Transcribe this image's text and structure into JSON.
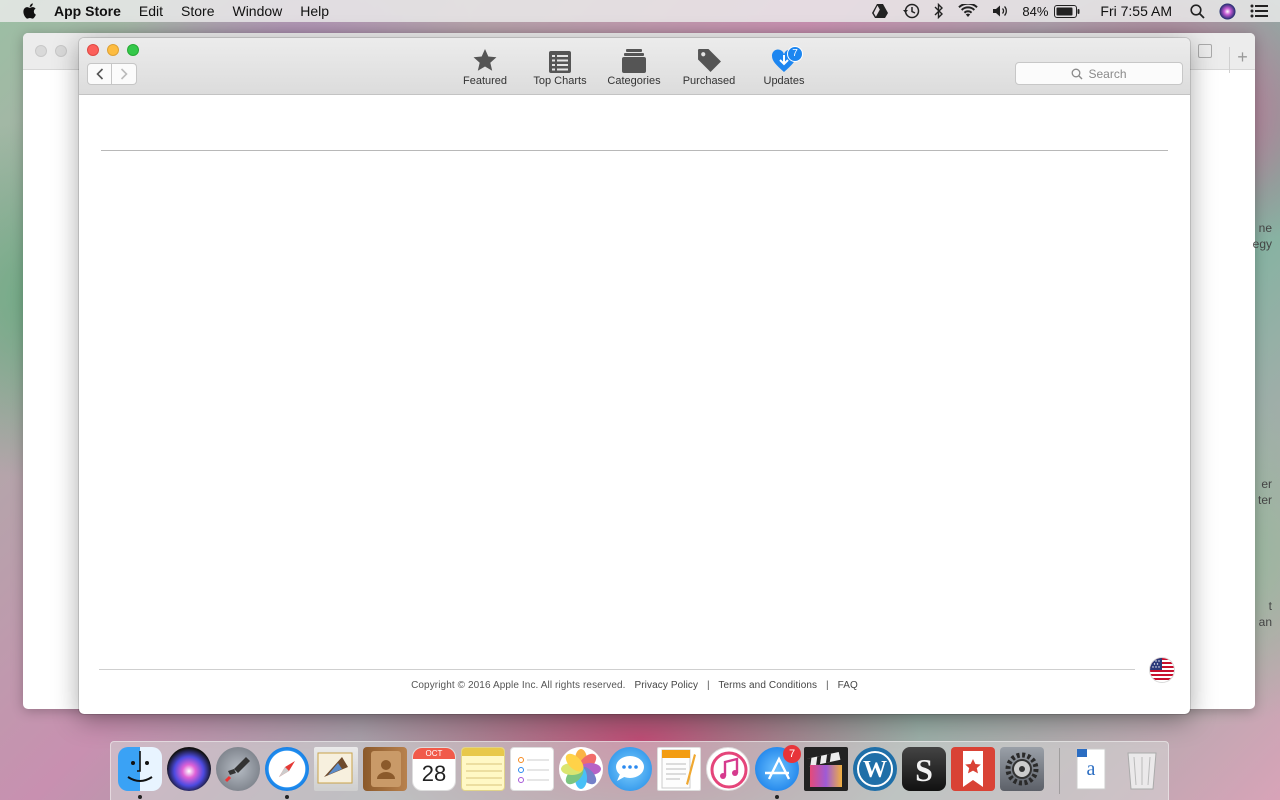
{
  "menubar": {
    "app_name": "App Store",
    "menus": [
      "Edit",
      "Store",
      "Window",
      "Help"
    ],
    "battery": "84%",
    "clock": "Fri 7:55 AM"
  },
  "background_window": {
    "edge_texts": [
      "ne\negy",
      "er\nter",
      "t\nan"
    ]
  },
  "window": {
    "toolbar": {
      "buttons": [
        {
          "label": "Featured",
          "icon": "star-icon"
        },
        {
          "label": "Top Charts",
          "icon": "list-icon"
        },
        {
          "label": "Categories",
          "icon": "boxes-icon"
        },
        {
          "label": "Purchased",
          "icon": "tag-icon"
        },
        {
          "label": "Updates",
          "icon": "updates-icon",
          "badge": "7"
        }
      ],
      "search_placeholder": "Search"
    },
    "footer": {
      "copyright": "Copyright © 2016 Apple Inc. All rights reserved.",
      "links": [
        "Privacy Policy",
        "Terms and Conditions",
        "FAQ"
      ],
      "separator": "|"
    }
  },
  "dock": {
    "apps": [
      {
        "name": "Finder",
        "icon": "finder-icon",
        "running": true
      },
      {
        "name": "Siri",
        "icon": "siri-icon"
      },
      {
        "name": "Launchpad",
        "icon": "launchpad-icon"
      },
      {
        "name": "Safari",
        "icon": "safari-icon",
        "running": true
      },
      {
        "name": "Mail",
        "icon": "mail-icon"
      },
      {
        "name": "Contacts",
        "icon": "contacts-icon"
      },
      {
        "name": "Calendar",
        "icon": "calendar-icon",
        "month": "OCT",
        "day": "28"
      },
      {
        "name": "Notes",
        "icon": "notes-icon"
      },
      {
        "name": "Reminders",
        "icon": "reminders-icon"
      },
      {
        "name": "Photos",
        "icon": "photos-icon"
      },
      {
        "name": "Messages",
        "icon": "messages-icon"
      },
      {
        "name": "Pages",
        "icon": "pages-icon"
      },
      {
        "name": "iTunes",
        "icon": "itunes-icon"
      },
      {
        "name": "App Store",
        "icon": "app-store-icon",
        "badge": "7",
        "running": true
      },
      {
        "name": "Final Cut Pro",
        "icon": "final-cut-icon"
      },
      {
        "name": "WordPress",
        "icon": "wordpress-icon"
      },
      {
        "name": "Scrivener",
        "icon": "scrivener-icon"
      },
      {
        "name": "Wunderlist",
        "icon": "wunderlist-icon"
      },
      {
        "name": "System Preferences",
        "icon": "system-preferences-icon"
      }
    ],
    "after_separator": [
      {
        "name": "Document",
        "icon": "document-stack-icon"
      },
      {
        "name": "Trash",
        "icon": "trash-icon"
      }
    ]
  }
}
